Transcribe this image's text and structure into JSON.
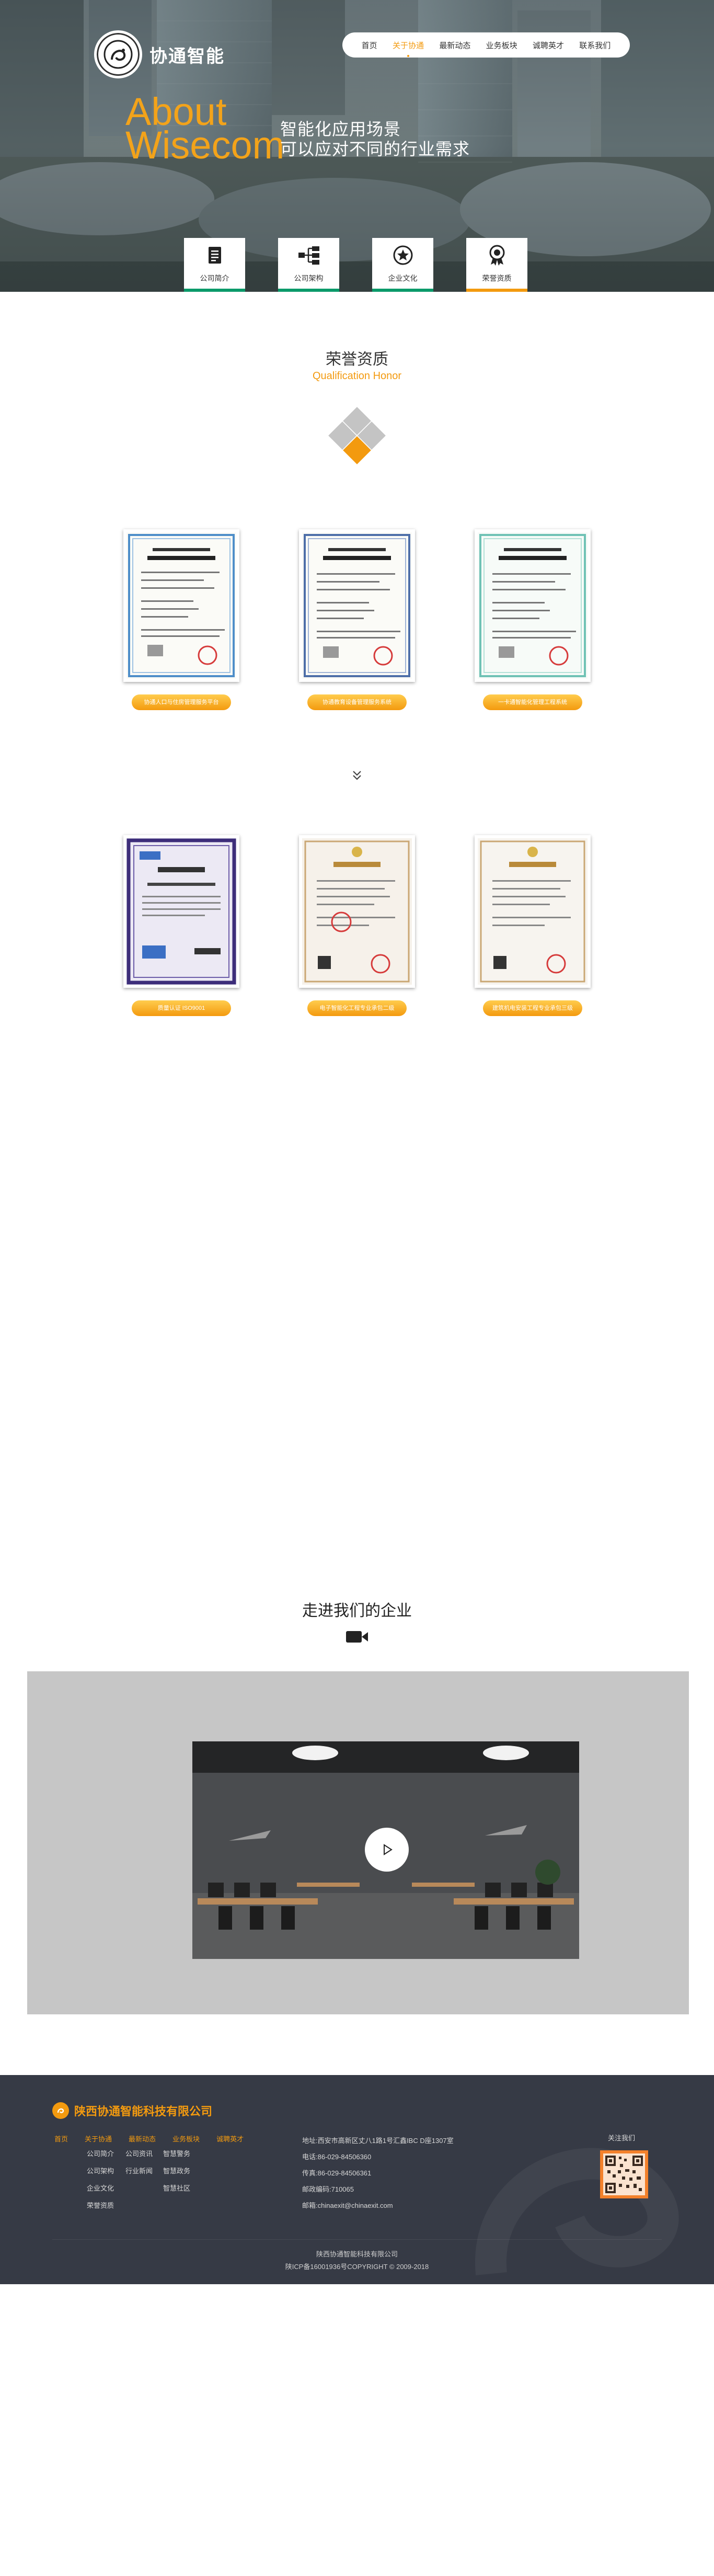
{
  "brand": {
    "name": "协通智能",
    "logo_icon": "company-logo"
  },
  "nav": {
    "items": [
      "首页",
      "关于协通",
      "最新动态",
      "业务板块",
      "诚聘英才",
      "联系我们"
    ],
    "active_index": 1
  },
  "hero": {
    "about_en_1": "About",
    "about_en_2": "Wisecom",
    "slogan_1": "智能化应用场景",
    "slogan_2": "可以应对不同的行业需求"
  },
  "subnav": {
    "items": [
      {
        "label": "公司简介",
        "icon": "document-icon"
      },
      {
        "label": "公司架构",
        "icon": "org-chart-icon"
      },
      {
        "label": "企业文化",
        "icon": "star-badge-icon"
      },
      {
        "label": "荣誉资质",
        "icon": "award-icon"
      }
    ],
    "active_index": 3
  },
  "honor": {
    "title": "荣誉资质",
    "subtitle": "Qualification Honor",
    "certificates": [
      {
        "label": "协通人口与住房管理服务平台"
      },
      {
        "label": "协通教育设备管理服务系统"
      },
      {
        "label": "一卡通智能化管理工程系统"
      },
      {
        "label": "质量认证 ISO9001"
      },
      {
        "label": "电子智能化工程专业承包二级"
      },
      {
        "label": "建筑机电安装工程专业承包三级"
      }
    ]
  },
  "video": {
    "title": "走进我们的企业"
  },
  "footer": {
    "company": "陕西协通智能科技有限公司",
    "nav": [
      "首页",
      "关于协通",
      "最新动态",
      "业务板块",
      "诚聘英才"
    ],
    "col1": [
      "公司简介",
      "公司架构",
      "企业文化",
      "荣誉资质"
    ],
    "col2": [
      "公司资讯",
      "行业新闻"
    ],
    "col3": [
      "智慧警务",
      "智慧政务",
      "智慧社区"
    ],
    "address": "地址:西安市高新区丈八1路1号汇鑫IBC D座1307室",
    "phone": "电话:86-029-84506360",
    "fax": "传真:86-029-84506361",
    "postcode": "邮政编码:710065",
    "email": "邮箱:chinaexit@chinaexit.com",
    "follow": "关注我们",
    "bottom_company": "陕西协通智能科技有限公司",
    "icp": "陕ICP备16001936号COPYRIGHT © 2009-2018"
  },
  "colors": {
    "accent": "#f39a0f",
    "green": "#0b9a6a",
    "footer_bg": "#363a45"
  }
}
